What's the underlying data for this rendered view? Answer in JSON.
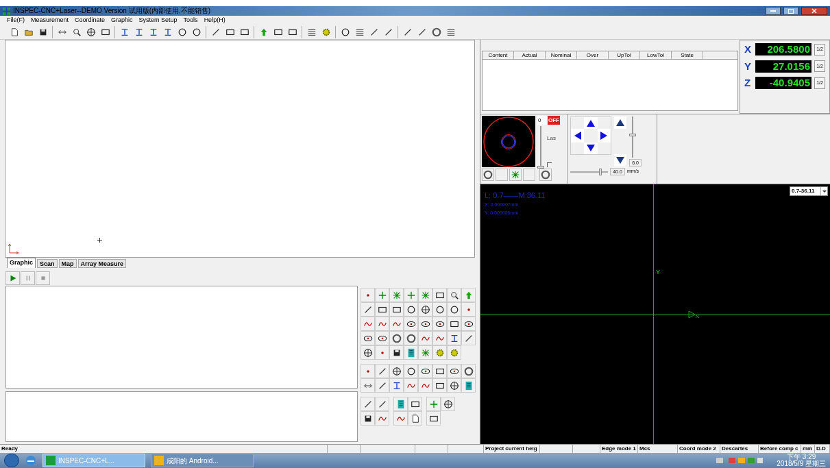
{
  "window": {
    "title": "INSPEC-CNC+Laser--DEMO  Version  试用版(内部使用,不能销售)"
  },
  "menu": [
    "File(F)",
    "Measurement",
    "Coordinate",
    "Graphic",
    "System Setup",
    "Tools",
    "Help(H)"
  ],
  "tabs": [
    {
      "label": "Graphic",
      "selected": true
    },
    {
      "label": "Scan",
      "selected": false
    },
    {
      "label": "Map",
      "selected": false
    },
    {
      "label": "Array Measure",
      "selected": false
    }
  ],
  "results_table": {
    "columns": [
      "Content",
      "Actual",
      "Nominal",
      "Over",
      "UpTol",
      "LowTol",
      "State"
    ]
  },
  "dro": [
    {
      "axis": "X",
      "value": "206.5800",
      "half": "1/2"
    },
    {
      "axis": "Y",
      "value": "27.0156",
      "half": "1/2"
    },
    {
      "axis": "Z",
      "value": "-40.9405",
      "half": "1/2"
    }
  ],
  "laser": {
    "value": "0",
    "switch": "OFF",
    "on": false,
    "label": "Las",
    "checked": false,
    "level": 0.0
  },
  "jog": {
    "z_speed": {
      "level": 0.55,
      "reading": "6.0"
    },
    "xy_speed": {
      "level": 0.8,
      "reading": "40.0",
      "unit": "mm/s"
    }
  },
  "camera": {
    "lens": "L: 0.7——M:36.11",
    "x_reading": "X: 0.000007mm",
    "y_reading": "Y: 0.000006mm",
    "axis_label": "Y",
    "zoom_select": "0.7-36.11"
  },
  "status_bar": {
    "message": "Ready",
    "project": "Project current heig",
    "fields": [
      "Edge mode 1",
      "Mcs",
      "Coord mode 2",
      "Descartes",
      "Before comp c",
      "mm",
      "D.D"
    ]
  },
  "taskbar": {
    "apps": [
      {
        "label": "INSPEC-CNC+L...",
        "selected": true
      },
      {
        "label": "咸阳的 Android...",
        "selected": false
      }
    ],
    "time": "下午 3:29",
    "date": "2018/5/9 星期三"
  }
}
